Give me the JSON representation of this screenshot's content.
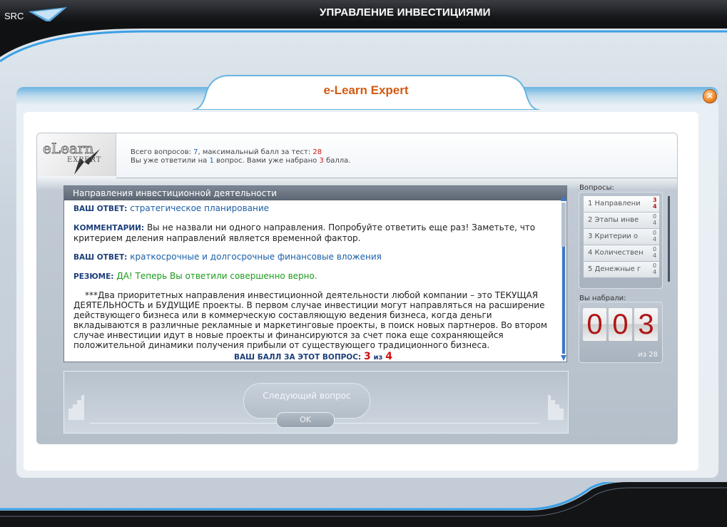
{
  "app": {
    "logo_text": "SRC",
    "title": "УПРАВЛЕНИЕ ИНВЕСТИЦИЯМИ"
  },
  "header": {
    "title": "e-Learn Expert",
    "close_label": "×"
  },
  "brand": {
    "line1": "eLearn",
    "line2": "EXPERT"
  },
  "info": {
    "line1_prefix": "Всего вопросов:",
    "total_questions": "7",
    "line1_mid": ", максимальный балл за тест:",
    "max_score": "28",
    "line2_prefix": "Вы уже ответили на",
    "answered": "1",
    "line2_mid": "вопрос. Вами уже набрано",
    "earned": "3",
    "line2_suffix": "балла."
  },
  "question": {
    "heading": "Направления инвестиционной деятельности",
    "answer1_label": "ВАШ ОТВЕТ:",
    "answer1_value": "стратегическое планирование",
    "comment_label": "КОММЕНТАРИИ:",
    "comment_value": "Вы не назвали ни одного направления. Попробуйте ответить еще раз! Заметьте, что критерием деления направлений является временной фактор.",
    "answer2_label": "ВАШ ОТВЕТ:",
    "answer2_value": "краткосрочные и долгосрочные финансовые вложения",
    "summary_label": "РЕЗЮМЕ:",
    "summary_value": "ДА! Теперь Вы ответили совершенно верно.",
    "explanation": "***Два приоритетных направления инвестиционной деятельности любой компании – это ТЕКУЩАЯ ДЕЯТЕЛЬНОСТЬ и БУДУЩИЕ проекты. В первом случае инвестиции могут направляться на расширение действующего бизнеса или в коммерческую составляющую ведения бизнеса, когда деньги вкладываются в различные рекламные и маркетинговые проекты, в поиск новых партнеров. Во втором случае инвестиции идут в новые проекты и финансируются за счет пока еще сохраняющейся положительной динамики получения прибыли от существующего традиционного бизнеса.",
    "score_label": "ВАШ БАЛЛ ЗА ЭТОТ ВОПРОС:",
    "score_value": "3",
    "score_of": "из",
    "score_max": "4"
  },
  "buttons": {
    "next": "Следующий вопрос",
    "ok": "OK"
  },
  "questions_panel": {
    "title": "Вопросы:",
    "items": [
      {
        "label": "1  Направлени",
        "pts_top": "3",
        "pts_bottom": "4"
      },
      {
        "label": "2  Этапы инве",
        "pts_top": "0",
        "pts_bottom": "4"
      },
      {
        "label": "3  Критерии о",
        "pts_top": "0",
        "pts_bottom": "4"
      },
      {
        "label": "4  Количествен",
        "pts_top": "0",
        "pts_bottom": "4"
      },
      {
        "label": "5  Денежные г",
        "pts_top": "0",
        "pts_bottom": "4"
      }
    ]
  },
  "score_panel": {
    "title": "Вы набрали:",
    "digits": [
      "0",
      "0",
      "3"
    ],
    "of_total": "из 28"
  },
  "colors": {
    "accent": "#d35a12",
    "blue": "#1a63b0",
    "red": "#cc1a1a",
    "green": "#1a9a1a"
  }
}
